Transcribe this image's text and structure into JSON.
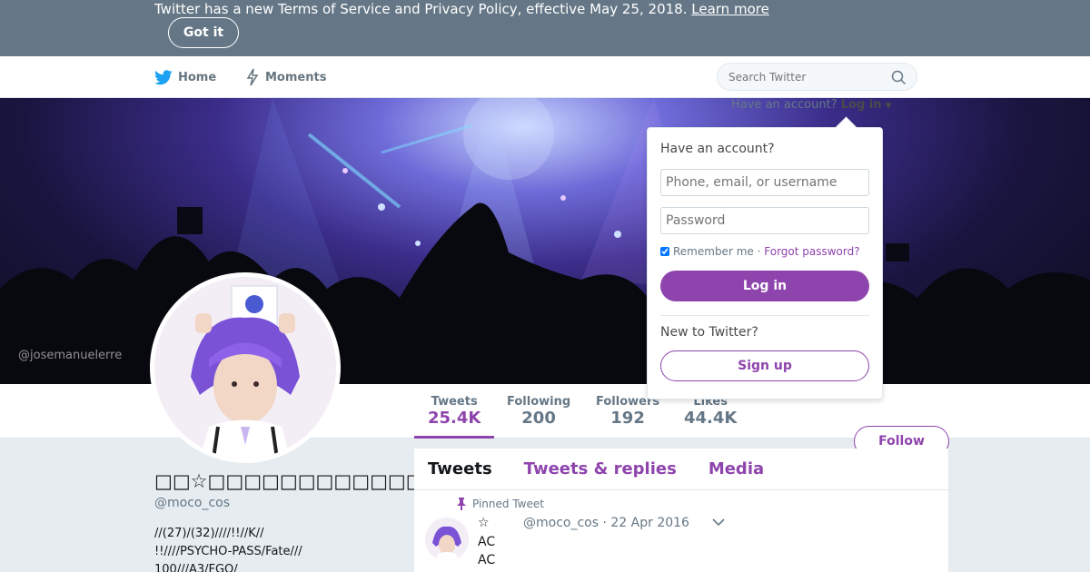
{
  "notice": {
    "text": "Twitter has a new Terms of Service and Privacy Policy, effective May 25, 2018.",
    "link": "Learn more",
    "button": "Got it"
  },
  "nav": {
    "home": "Home",
    "moments": "Moments",
    "search_placeholder": "Search Twitter"
  },
  "banner": {
    "watermark": "@josemanuelerre",
    "login_prompt": "Have an account?",
    "login_link": "Log in"
  },
  "stats": [
    {
      "label": "Tweets",
      "value": "25.4K"
    },
    {
      "label": "Following",
      "value": "200"
    },
    {
      "label": "Followers",
      "value": "192"
    },
    {
      "label": "Likes",
      "value": "44.4K"
    }
  ],
  "follow_button": "Follow",
  "profile": {
    "name": "□□☆□□□□□□□□□□□□□□",
    "handle": "@moco_cos",
    "bio_lines": [
      "//(27)/(32)////!!//K//",
      "!!////PSYCHO-PASS/Fate///",
      "100///A3/FGO/"
    ]
  },
  "timeline": {
    "tabs": [
      "Tweets",
      "Tweets & replies",
      "Media"
    ],
    "pinned_label": "Pinned Tweet",
    "tweet": {
      "star": "☆",
      "handle": "@moco_cos",
      "date": "· 22 Apr 2016",
      "lines": [
        "AC",
        "AC"
      ]
    }
  },
  "login_dropdown": {
    "heading": "Have an account?",
    "username_placeholder": "Phone, email, or username",
    "password_placeholder": "Password",
    "remember": "Remember me",
    "separator": "·",
    "forgot": "Forgot password?",
    "login_button": "Log in",
    "new_label": "New to Twitter?",
    "signup_button": "Sign up"
  },
  "colors": {
    "accent": "#8e44ad",
    "notice_bg": "#657786",
    "twitter_blue": "#1da1f2"
  }
}
